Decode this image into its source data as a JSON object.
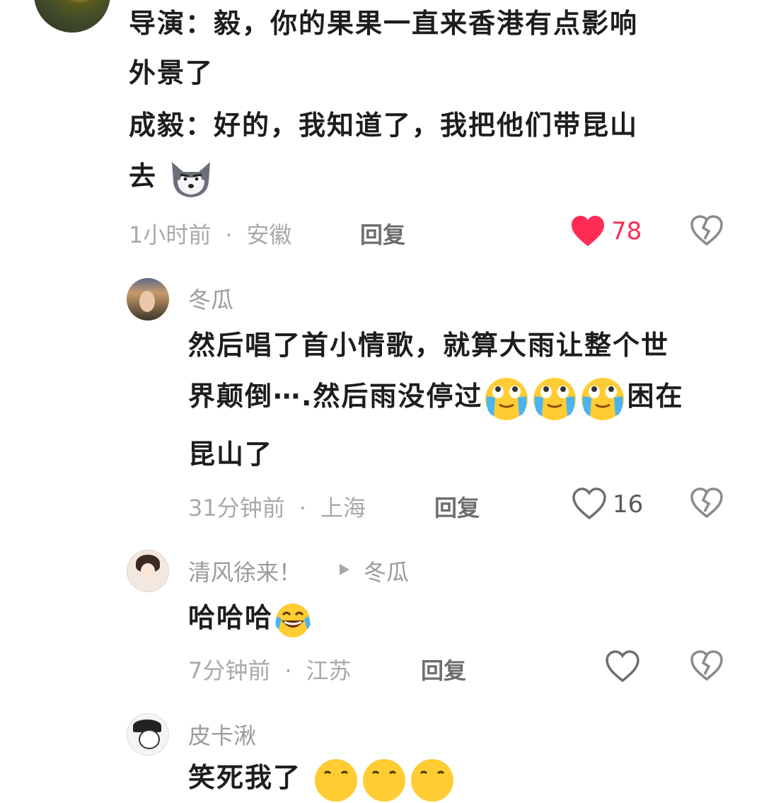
{
  "comments": [
    {
      "lines": [
        "导演：毅，你的果果一直来香港有点影响",
        "外景了",
        "成毅：好的，我知道了，我把他们带昆山",
        "去"
      ],
      "time": "1小时前",
      "location": "安徽",
      "reply_label": "回复",
      "likes": "78",
      "liked": true,
      "inline_emoji": "dog-face-emoji"
    },
    {
      "author": "冬瓜",
      "lines": [
        "然后唱了首小情歌，就算大雨让整个世",
        "界颠倒⋯.然后雨没停过",
        "困在",
        "昆山了"
      ],
      "time": "31分钟前",
      "location": "上海",
      "reply_label": "回复",
      "likes": "16"
    },
    {
      "author": "清风徐来！",
      "reply_to": "冬瓜",
      "text": "哈哈哈",
      "time": "7分钟前",
      "location": "江苏",
      "reply_label": "回复"
    },
    {
      "author": "皮卡湫",
      "text_partial": "笑死我了"
    }
  ],
  "meta_dot": "·",
  "colors": {
    "like_red": "#fe2c55",
    "text": "#1d1d1d",
    "muted": "#a9a9a9"
  }
}
